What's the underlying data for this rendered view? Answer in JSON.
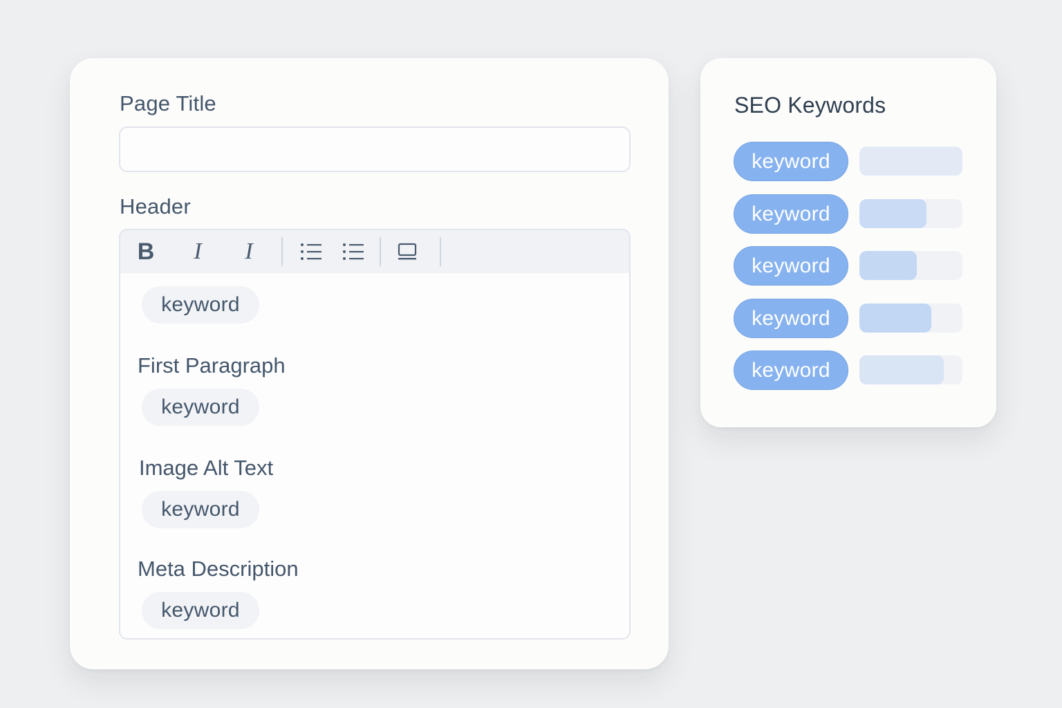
{
  "editor": {
    "page_title_label": "Page Title",
    "page_title_value": "",
    "header_label": "Header",
    "toolbar": [
      {
        "name": "bold-icon",
        "label": "B"
      },
      {
        "name": "italic-icon",
        "label": "I"
      },
      {
        "name": "italic-alt-icon",
        "label": "I"
      },
      {
        "name": "bulleted-list-icon",
        "label": ""
      },
      {
        "name": "numbered-list-icon",
        "label": ""
      },
      {
        "name": "image-icon",
        "label": ""
      }
    ],
    "sections": [
      {
        "label": "",
        "keyword": "keyword"
      },
      {
        "label": "First Paragraph",
        "keyword": "keyword"
      },
      {
        "label": "Image Alt Text",
        "keyword": "keyword"
      },
      {
        "label": "Meta Description",
        "keyword": "keyword"
      }
    ]
  },
  "seo": {
    "title": "SEO Keywords",
    "keywords": [
      {
        "label": "keyword",
        "strength": 1.0,
        "color": "#e3eaf6"
      },
      {
        "label": "keyword",
        "strength": 0.65,
        "color": "#c9dbf5"
      },
      {
        "label": "keyword",
        "strength": 0.56,
        "color": "#c4d8f4"
      },
      {
        "label": "keyword",
        "strength": 0.7,
        "color": "#c2d7f3"
      },
      {
        "label": "keyword",
        "strength": 0.82,
        "color": "#d9e4f5"
      }
    ]
  },
  "colors": {
    "accent": "#86b2ef",
    "background": "#eeeff0",
    "card": "#fcfcfb",
    "text": "#44566b"
  }
}
